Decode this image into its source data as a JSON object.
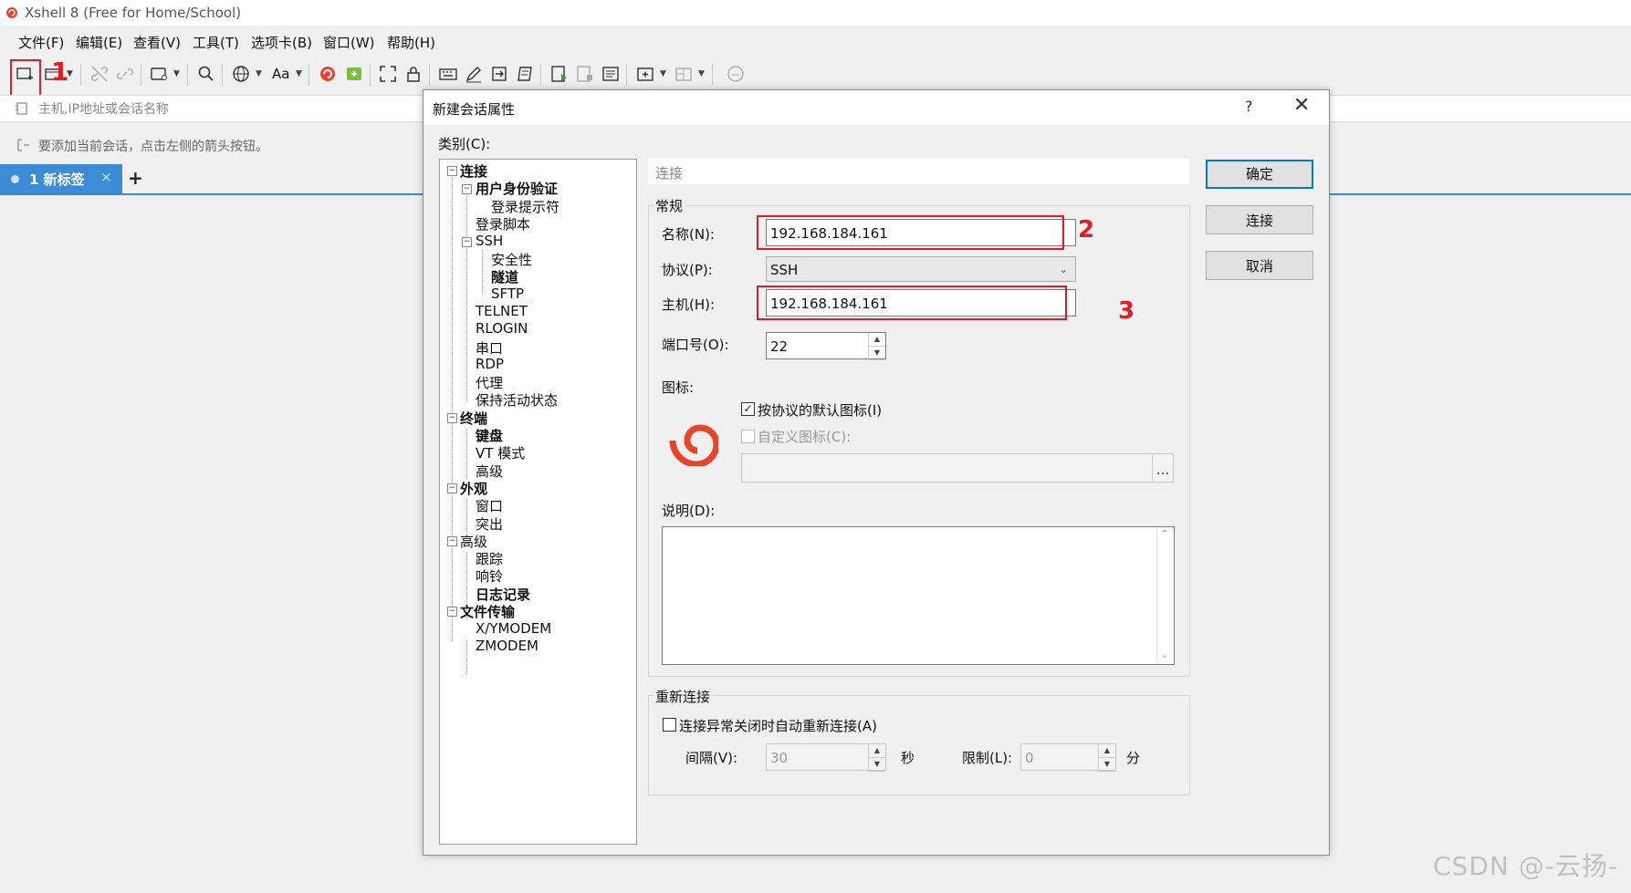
{
  "window": {
    "title": "Xshell 8 (Free for Home/School)"
  },
  "menu": [
    "文件(F)",
    "编辑(E)",
    "查看(V)",
    "工具(T)",
    "选项卡(B)",
    "窗口(W)",
    "帮助(H)"
  ],
  "address": {
    "placeholder": "主机,IP地址或会话名称"
  },
  "hint": "要添加当前会话，点击左侧的箭头按钮。",
  "tabs": [
    {
      "label": "1 新标签",
      "close": "×"
    }
  ],
  "tab_add": "+",
  "toolbar": {
    "font_label": "Aa"
  },
  "annotations": [
    "1",
    "2",
    "3"
  ],
  "dialog": {
    "title": "新建会话属性",
    "help": "?",
    "close": "✕",
    "category_label": "类别(C):",
    "tree": [
      {
        "label": "连接",
        "bold": true
      },
      {
        "label": "用户身份验证",
        "bold": true
      },
      {
        "label": "登录提示符",
        "bold": false
      },
      {
        "label": "登录脚本",
        "bold": false
      },
      {
        "label": "SSH",
        "bold": false
      },
      {
        "label": "安全性",
        "bold": false
      },
      {
        "label": "隧道",
        "bold": true
      },
      {
        "label": "SFTP",
        "bold": false
      },
      {
        "label": "TELNET",
        "bold": false
      },
      {
        "label": "RLOGIN",
        "bold": false
      },
      {
        "label": "串口",
        "bold": false
      },
      {
        "label": "RDP",
        "bold": false
      },
      {
        "label": "代理",
        "bold": false
      },
      {
        "label": "保持活动状态",
        "bold": false
      },
      {
        "label": "终端",
        "bold": true
      },
      {
        "label": "键盘",
        "bold": true
      },
      {
        "label": "VT 模式",
        "bold": false
      },
      {
        "label": "高级",
        "bold": false
      },
      {
        "label": "外观",
        "bold": true
      },
      {
        "label": "窗口",
        "bold": false
      },
      {
        "label": "突出",
        "bold": false
      },
      {
        "label": "高级",
        "bold": false
      },
      {
        "label": "跟踪",
        "bold": false
      },
      {
        "label": "响铃",
        "bold": false
      },
      {
        "label": "日志记录",
        "bold": true
      },
      {
        "label": "文件传输",
        "bold": true
      },
      {
        "label": "X/YMODEM",
        "bold": false
      },
      {
        "label": "ZMODEM",
        "bold": false
      }
    ],
    "section_header": "连接",
    "general_label": "常规",
    "name_label": "名称(N):",
    "name_value": "192.168.184.161",
    "protocol_label": "协议(P):",
    "protocol_value": "SSH",
    "host_label": "主机(H):",
    "host_value": "192.168.184.161",
    "port_label": "端口号(O):",
    "port_value": "22",
    "icon_label": "图标:",
    "default_icon_label": "按协议的默认图标(I)",
    "default_icon_checked": "✓",
    "custom_icon_label": "自定义图标(C):",
    "browse": "...",
    "description_label": "说明(D):",
    "reconnect_label": "重新连接",
    "auto_reconnect_label": "连接异常关闭时自动重新连接(A)",
    "interval_label": "间隔(V):",
    "interval_value": "30",
    "seconds": "秒",
    "limit_label": "限制(L):",
    "limit_value": "0",
    "minutes": "分",
    "ok": "确定",
    "connect": "连接",
    "cancel": "取消"
  },
  "watermark": "CSDN @-云扬-",
  "colors": {
    "accent": "#3b8bd6",
    "annotation": "#e31b23"
  }
}
